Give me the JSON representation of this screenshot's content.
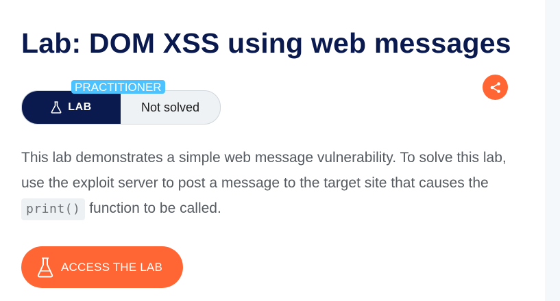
{
  "header": {
    "title": "Lab: DOM XSS using web messages"
  },
  "lab_badge": {
    "level": "PRACTITIONER",
    "lab_label": "LAB",
    "status": "Not solved"
  },
  "description": {
    "text_before_code": "This lab demonstrates a simple web message vulnerability. To solve this lab, use the exploit server to post a message to the target site that causes the ",
    "code": "print()",
    "text_after_code": " function to be called."
  },
  "actions": {
    "access_label": "ACCESS THE LAB",
    "share_icon": "share-icon"
  },
  "colors": {
    "title": "#0a1a4f",
    "accent": "#ff6633",
    "level_tag": "#4cc3ff",
    "lab_pill": "#0a1a4f"
  }
}
